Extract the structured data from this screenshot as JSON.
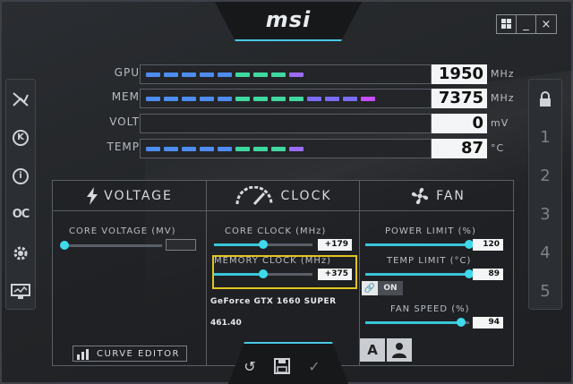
{
  "brand": {
    "logo": "msi"
  },
  "window_buttons": [
    {
      "name": "windows-icon"
    },
    {
      "name": "minimize-icon",
      "label": "_"
    },
    {
      "name": "close-icon",
      "label": "×"
    }
  ],
  "left_sidebar": [
    {
      "name": "oc-scanner-icon"
    },
    {
      "name": "k-boost-icon",
      "label": "K"
    },
    {
      "name": "info-icon",
      "label": "i"
    },
    {
      "name": "oc-icon",
      "label": "OC"
    },
    {
      "name": "settings-gear-icon"
    },
    {
      "name": "monitor-icon"
    }
  ],
  "right_sidebar": {
    "lock_icon": "lock-icon",
    "profiles": [
      "1",
      "2",
      "3",
      "4",
      "5"
    ]
  },
  "monitors": [
    {
      "label": "GPU",
      "value": "1950",
      "unit": "MHz",
      "fill": 0.66,
      "color": "#6fa8ff"
    },
    {
      "label": "MEM",
      "value": "7375",
      "unit": "MHz",
      "fill": 0.94,
      "color": "#c84dff"
    },
    {
      "label": "VOLT",
      "value": "0",
      "unit": "mV",
      "fill": 0.0,
      "color": "#6fa8ff"
    },
    {
      "label": "TEMP",
      "value": "87",
      "unit": "°C",
      "fill": 0.66,
      "color": "#6fa8ff"
    }
  ],
  "voltage": {
    "title": "VOLTAGE",
    "core_voltage_label": "CORE VOLTAGE (MV)",
    "core_voltage_value": "",
    "curve_editor_label": "CURVE EDITOR"
  },
  "clock": {
    "title": "CLOCK",
    "core_clock_label": "CORE CLOCK (MHz)",
    "core_clock_value": "+179",
    "core_clock_level": 0.5,
    "memory_clock_label": "MEMORY CLOCK (MHz)",
    "memory_clock_value": "+375",
    "memory_clock_level": 0.5,
    "gpu_name": "GeForce GTX 1660 SUPER",
    "driver_version": "461.40"
  },
  "fan": {
    "title": "FAN",
    "power_limit_label": "POWER LIMIT (%)",
    "power_limit_value": "120",
    "power_limit_level": 1.0,
    "temp_limit_label": "TEMP LIMIT (°C)",
    "temp_limit_value": "89",
    "temp_limit_level": 1.0,
    "link_label": "ON",
    "fan_speed_label": "FAN SPEED (%)",
    "fan_speed_value": "94",
    "fan_speed_level": 0.92,
    "auto_label": "A"
  },
  "toolbar": [
    {
      "name": "reset-icon",
      "label": "↺"
    },
    {
      "name": "save-icon"
    },
    {
      "name": "apply-check-icon",
      "label": "✓"
    }
  ]
}
